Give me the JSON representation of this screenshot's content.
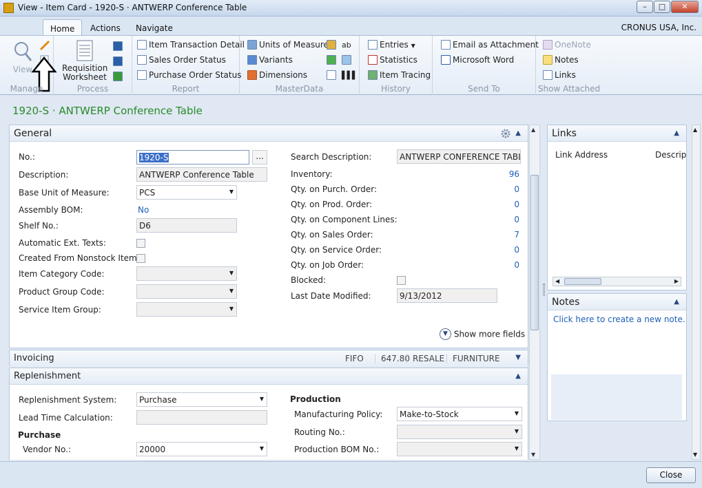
{
  "window": {
    "title": "View - Item Card - 1920-S · ANTWERP Conference Table"
  },
  "ribbon": {
    "tabs": [
      "Home",
      "Actions",
      "Navigate"
    ],
    "company": "CRONUS USA, Inc.",
    "groups": {
      "manage": {
        "label": "Manage",
        "view": "View"
      },
      "process": {
        "label": "Process",
        "requisition": "Requisition Worksheet"
      },
      "report": {
        "label": "Report",
        "items": [
          "Item Transaction Detail",
          "Sales Order Status",
          "Purchase Order Status"
        ]
      },
      "masterdata": {
        "label": "MasterData",
        "items": [
          "Units of Measure",
          "Variants",
          "Dimensions"
        ]
      },
      "history": {
        "label": "History",
        "items": [
          "Entries",
          "Statistics",
          "Item Tracing"
        ]
      },
      "sendto": {
        "label": "Send To",
        "items": [
          "Email as Attachment",
          "Microsoft Word"
        ]
      },
      "showattached": {
        "label": "Show Attached",
        "items": [
          "OneNote",
          "Notes",
          "Links"
        ]
      }
    }
  },
  "page_title": "1920-S · ANTWERP Conference Table",
  "general": {
    "title": "General",
    "left": [
      {
        "label": "No.:",
        "value": "1920-S"
      },
      {
        "label": "Description:",
        "value": "ANTWERP Conference Table"
      },
      {
        "label": "Base Unit of Measure:",
        "value": "PCS"
      },
      {
        "label": "Assembly BOM:",
        "value": "No"
      },
      {
        "label": "Shelf No.:",
        "value": "D6"
      },
      {
        "label": "Automatic Ext. Texts:",
        "value": ""
      },
      {
        "label": "Created From Nonstock Item:",
        "value": ""
      },
      {
        "label": "Item Category Code:",
        "value": ""
      },
      {
        "label": "Product Group Code:",
        "value": ""
      },
      {
        "label": "Service Item Group:",
        "value": ""
      }
    ],
    "right": [
      {
        "label": "Search Description:",
        "value": "ANTWERP CONFERENCE TABLE"
      },
      {
        "label": "Inventory:",
        "value": "96"
      },
      {
        "label": "Qty. on Purch. Order:",
        "value": "0"
      },
      {
        "label": "Qty. on Prod. Order:",
        "value": "0"
      },
      {
        "label": "Qty. on Component Lines:",
        "value": "0"
      },
      {
        "label": "Qty. on Sales Order:",
        "value": "7"
      },
      {
        "label": "Qty. on Service Order:",
        "value": "0"
      },
      {
        "label": "Qty. on Job Order:",
        "value": "0"
      },
      {
        "label": "Blocked:",
        "value": ""
      },
      {
        "label": "Last Date Modified:",
        "value": "9/13/2012"
      }
    ],
    "show_more": "Show more fields"
  },
  "invoicing": {
    "title": "Invoicing",
    "summary": [
      "FIFO",
      "647.80",
      "RESALE",
      "FURNITURE"
    ]
  },
  "replenishment": {
    "title": "Replenishment",
    "fields": [
      {
        "label": "Replenishment System:",
        "value": "Purchase"
      },
      {
        "label": "Lead Time Calculation:",
        "value": ""
      }
    ],
    "purchase_header": "Purchase",
    "vendor": {
      "label": "Vendor No.:",
      "value": "20000"
    },
    "production_header": "Production",
    "production": [
      {
        "label": "Manufacturing Policy:",
        "value": "Make-to-Stock"
      },
      {
        "label": "Routing No.:",
        "value": ""
      },
      {
        "label": "Production BOM No.:",
        "value": ""
      }
    ]
  },
  "factbox": {
    "links": {
      "title": "Links",
      "col1": "Link Address",
      "col2": "Descrip"
    },
    "notes": {
      "title": "Notes",
      "create": "Click here to create a new note."
    }
  },
  "close_label": "Close"
}
